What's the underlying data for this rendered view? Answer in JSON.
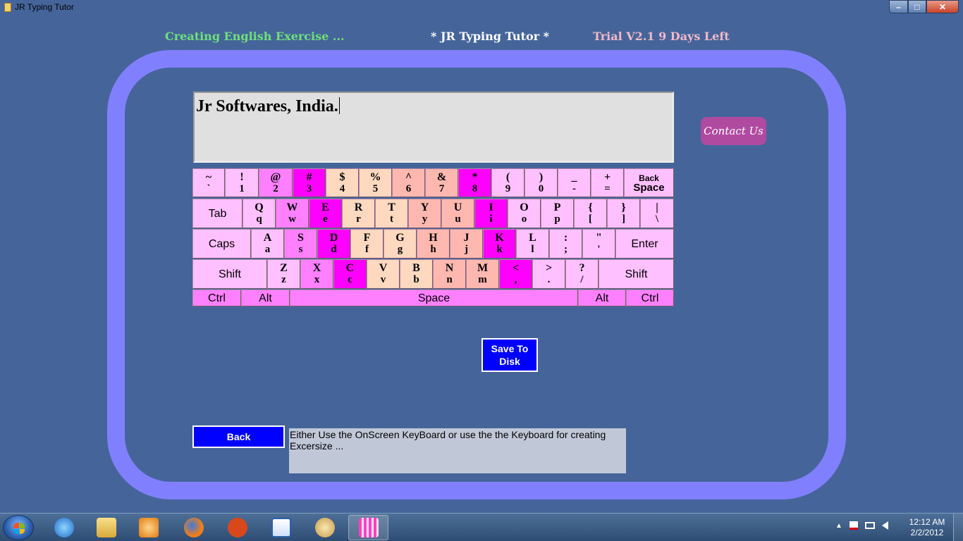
{
  "window": {
    "title": "JR Typing Tutor",
    "minimize": "–",
    "maximize": "□",
    "close": "✕"
  },
  "header": {
    "left": "Creating English Exercise ...",
    "center": "* JR Typing Tutor *",
    "right": "Trial V2.1  9 Days Left"
  },
  "display_text": "Jr Softwares, India.",
  "contact_label": "Contact Us",
  "keyboard": {
    "row1": [
      {
        "up": "~",
        "lo": "`",
        "c": "pink"
      },
      {
        "up": "!",
        "lo": "1",
        "c": "pink"
      },
      {
        "up": "@",
        "lo": "2",
        "c": "mid"
      },
      {
        "up": "#",
        "lo": "3",
        "c": "mag"
      },
      {
        "up": "$",
        "lo": "4",
        "c": "peach"
      },
      {
        "up": "%",
        "lo": "5",
        "c": "peach"
      },
      {
        "up": "^",
        "lo": "6",
        "c": "salmon"
      },
      {
        "up": "&",
        "lo": "7",
        "c": "salmon"
      },
      {
        "up": "*",
        "lo": "8",
        "c": "mag"
      },
      {
        "up": "(",
        "lo": "9",
        "c": "pink"
      },
      {
        "up": ")",
        "lo": "0",
        "c": "pink"
      },
      {
        "up": "_",
        "lo": "-",
        "c": "pink"
      },
      {
        "up": "+",
        "lo": "=",
        "c": "pink"
      },
      {
        "up": "Back",
        "lo": "Space",
        "c": "pink",
        "bs": true
      }
    ],
    "row2": [
      {
        "word": "Tab",
        "c": "pink"
      },
      {
        "up": "Q",
        "lo": "q",
        "c": "pink"
      },
      {
        "up": "W",
        "lo": "w",
        "c": "mid"
      },
      {
        "up": "E",
        "lo": "e",
        "c": "mag"
      },
      {
        "up": "R",
        "lo": "r",
        "c": "peach"
      },
      {
        "up": "T",
        "lo": "t",
        "c": "peach"
      },
      {
        "up": "Y",
        "lo": "y",
        "c": "salmon"
      },
      {
        "up": "U",
        "lo": "u",
        "c": "salmon"
      },
      {
        "up": "I",
        "lo": "i",
        "c": "mag"
      },
      {
        "up": "O",
        "lo": "o",
        "c": "pink"
      },
      {
        "up": "P",
        "lo": "p",
        "c": "pink"
      },
      {
        "up": "{",
        "lo": "[",
        "c": "pink"
      },
      {
        "up": "}",
        "lo": "]",
        "c": "pink"
      },
      {
        "up": "|",
        "lo": "\\",
        "c": "pink"
      }
    ],
    "row3": [
      {
        "word": "Caps",
        "c": "pink"
      },
      {
        "up": "A",
        "lo": "a",
        "c": "pink"
      },
      {
        "up": "S",
        "lo": "s",
        "c": "mid"
      },
      {
        "up": "D",
        "lo": "d",
        "c": "mag"
      },
      {
        "up": "F",
        "lo": "f",
        "c": "peach"
      },
      {
        "up": "G",
        "lo": "g",
        "c": "peach"
      },
      {
        "up": "H",
        "lo": "h",
        "c": "salmon"
      },
      {
        "up": "J",
        "lo": "j",
        "c": "salmon"
      },
      {
        "up": "K",
        "lo": "k",
        "c": "mag"
      },
      {
        "up": "L",
        "lo": "l",
        "c": "pink"
      },
      {
        "up": ":",
        "lo": ";",
        "c": "pink"
      },
      {
        "up": "\"",
        "lo": "'",
        "c": "pink"
      },
      {
        "word": "Enter",
        "c": "pink"
      }
    ],
    "row4": [
      {
        "word": "Shift",
        "c": "pink"
      },
      {
        "up": "Z",
        "lo": "z",
        "c": "pink"
      },
      {
        "up": "X",
        "lo": "x",
        "c": "mid"
      },
      {
        "up": "C",
        "lo": "c",
        "c": "mag"
      },
      {
        "up": "V",
        "lo": "v",
        "c": "peach"
      },
      {
        "up": "B",
        "lo": "b",
        "c": "peach"
      },
      {
        "up": "N",
        "lo": "n",
        "c": "salmon"
      },
      {
        "up": "M",
        "lo": "m",
        "c": "salmon"
      },
      {
        "up": "<",
        "lo": ",",
        "c": "mag"
      },
      {
        "up": ">",
        "lo": ".",
        "c": "pink"
      },
      {
        "up": "?",
        "lo": "/",
        "c": "pink"
      },
      {
        "word": "Shift",
        "c": "pink"
      }
    ],
    "row5": [
      {
        "word": "Ctrl",
        "c": "mid"
      },
      {
        "word": "Alt",
        "c": "mid"
      },
      {
        "word": "Space",
        "c": "mid"
      },
      {
        "word": "Alt",
        "c": "mid"
      },
      {
        "word": "Ctrl",
        "c": "mid"
      }
    ]
  },
  "save_label_1": "Save To",
  "save_label_2": "Disk",
  "back_label": "Back",
  "info_text": "Either Use the OnScreen KeyBoard or use the the Keyboard for creating Excersize ...",
  "taskbar": {
    "apps": [
      "windows-explorer-icon",
      "internet-explorer-icon",
      "file-explorer-icon",
      "media-player-icon",
      "firefox-icon",
      "miro-icon",
      "word-icon",
      "paint-icon",
      "jr-typing-tutor-icon"
    ],
    "tray_arrow": "▲",
    "time": "12:12 AM",
    "date": "2/2/2012"
  },
  "colors": {
    "pink": "#ffc0ff",
    "mag": "#ff00ff",
    "mid": "#ff80ff",
    "peach": "#ffd8c0",
    "salmon": "#ffb8b0",
    "frame": "#8080ff",
    "background": "#45659a"
  }
}
